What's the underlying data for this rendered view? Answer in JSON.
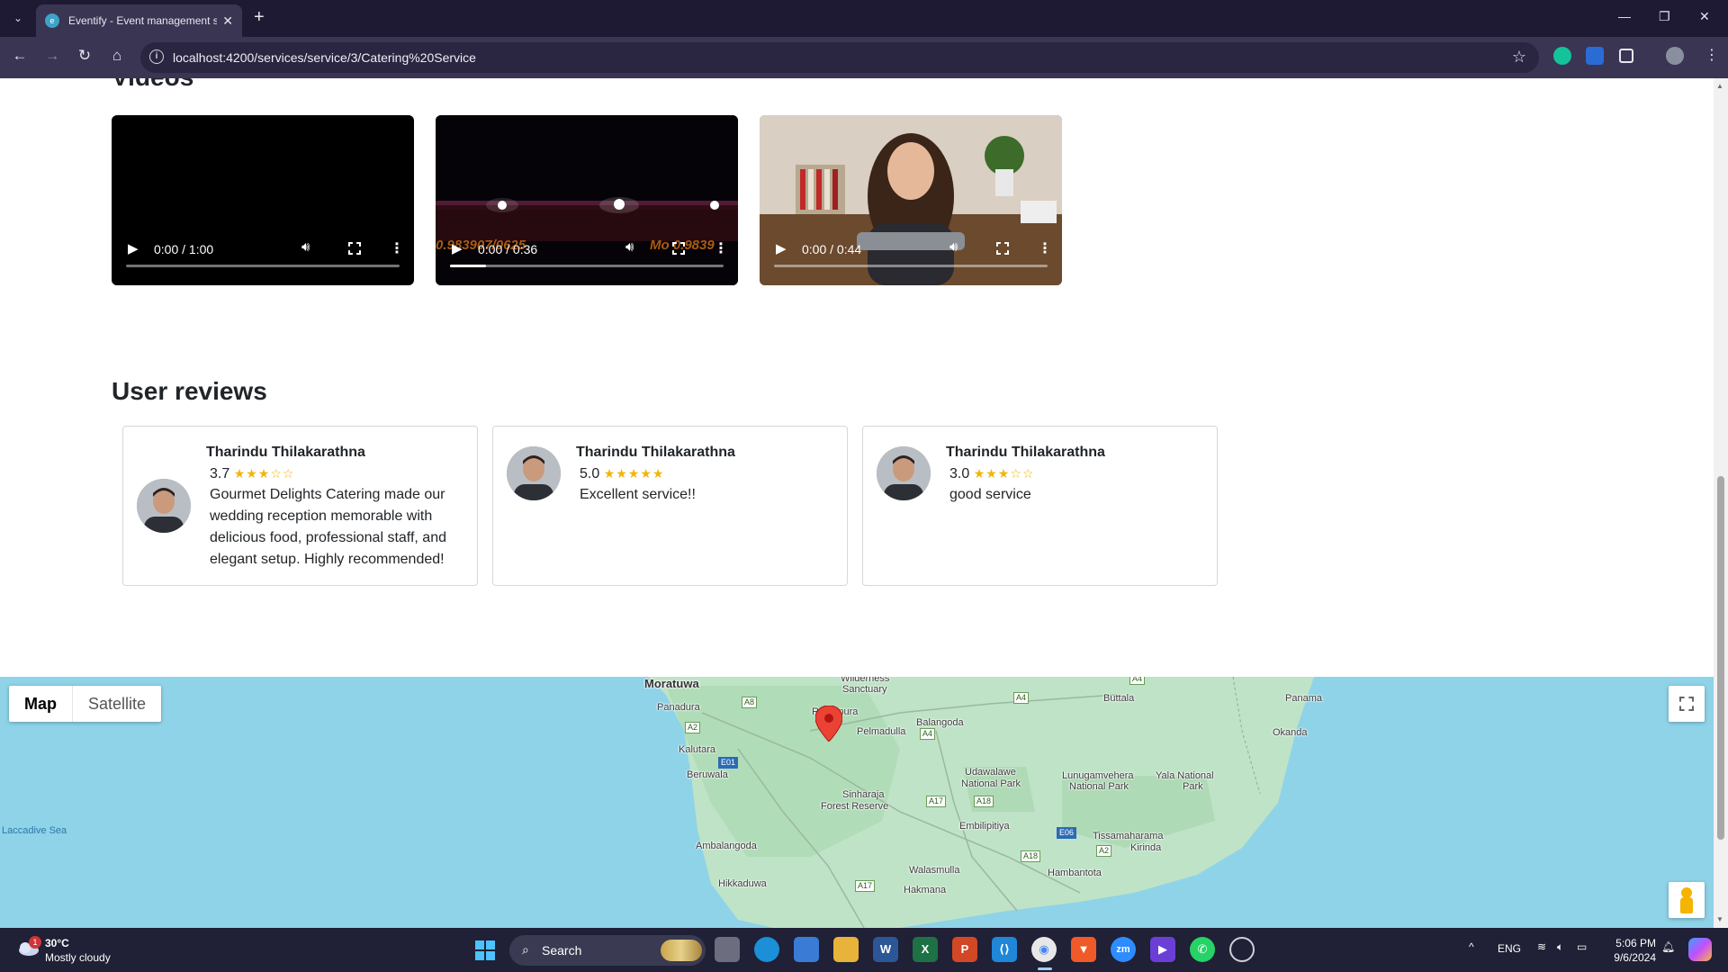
{
  "browser": {
    "tab_title": "Eventify - Event management s",
    "url": "localhost:4200/services/service/3/Catering%20Service"
  },
  "videos": {
    "heading": "Videos",
    "items": [
      {
        "time": "0:00 / 1:00",
        "progress": 0.0
      },
      {
        "time": "0:00 / 0:36",
        "progress": 0.13,
        "overlay_left": "0.983907/0625",
        "overlay_right": "Mo 0.9839"
      },
      {
        "time": "0:00 / 0:44",
        "progress": 0.0
      }
    ]
  },
  "reviews": {
    "heading": "User reviews",
    "items": [
      {
        "name": "Tharindu Thilakarathna",
        "rating": "3.7",
        "stars": "★★★☆☆",
        "text": "Gourmet Delights Catering made our wedding reception memorable with delicious food, professional staff, and elegant setup. Highly recommended!"
      },
      {
        "name": "Tharindu Thilakarathna",
        "rating": "5.0",
        "stars": "★★★★★",
        "text": "Excellent service!!"
      },
      {
        "name": "Tharindu Thilakarathna",
        "rating": "3.0",
        "stars": "★★★☆☆",
        "text": "good service"
      }
    ]
  },
  "map": {
    "type_map": "Map",
    "type_satellite": "Satellite",
    "places": {
      "moratuwa": "Moratuwa",
      "panadura": "Panadura",
      "kalutara": "Kalutara",
      "beruwala": "Beruwala",
      "ambalangoda": "Ambalangoda",
      "hikkaduwa": "Hikkaduwa",
      "ratnapura": "Ratnapura",
      "pelmadulla": "Pelmadulla",
      "balangoda": "Balangoda",
      "wilderness": "Wilderness",
      "sanctuary": "Sanctuary",
      "sinharaja": "Sinharaja",
      "forest_reserve": "Forest Reserve",
      "udawalawe": "Udawalawe",
      "udawalawe_np": "National Park",
      "embilipitiya": "Embilipitiya",
      "walasmulla": "Walasmulla",
      "hakmana": "Hakmana",
      "hambantota": "Hambantota",
      "tissamaharama": "Tissamaharama",
      "kirinda": "Kirinda",
      "lunugamvehera": "Lunugamvehera",
      "lunugamvehera_np": "National Park",
      "yala": "Yala National",
      "yala_park": "Park",
      "buttala": "Buttala",
      "panama": "Panama",
      "okanda": "Okanda",
      "laccadive": "Laccadive Sea"
    },
    "roads": {
      "a8": "A8",
      "a2a": "A2",
      "e01": "E01",
      "a4a": "A4",
      "a4b": "A4",
      "a4c": "A4",
      "a17a": "A17",
      "a17b": "A17",
      "a18a": "A18",
      "a18b": "A18",
      "e06": "E06",
      "a2b": "A2"
    }
  },
  "taskbar": {
    "weather_badge": "1",
    "weather_temp": "30°C",
    "weather_desc": "Mostly cloudy",
    "search": "Search",
    "lang": "ENG",
    "time": "5:06 PM",
    "date": "9/6/2024"
  }
}
